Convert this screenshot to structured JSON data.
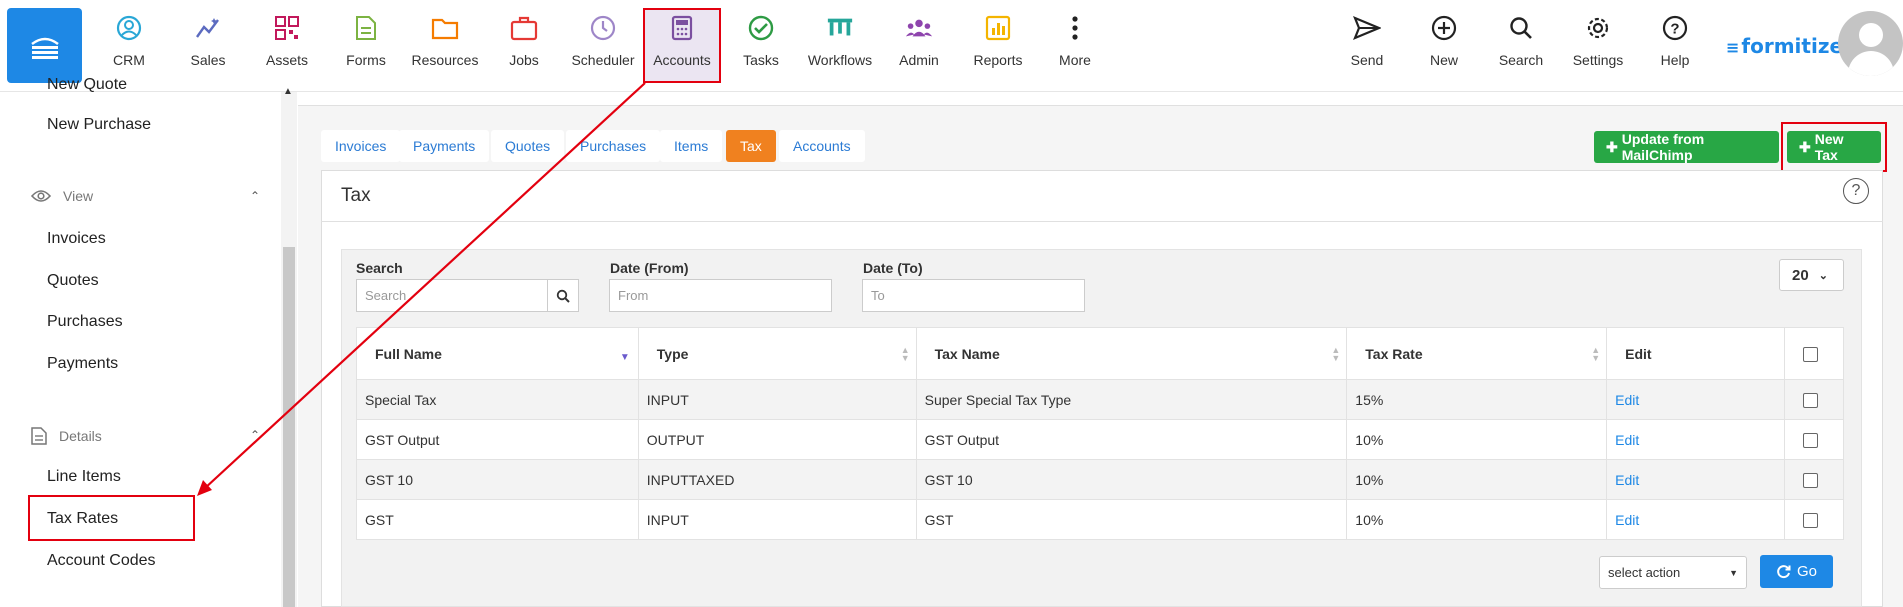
{
  "nav": {
    "items": [
      {
        "label": "CRM",
        "icon": "crm-icon",
        "color": "#29a7d6"
      },
      {
        "label": "Sales",
        "icon": "sales-icon",
        "color": "#5c6bc0"
      },
      {
        "label": "Assets",
        "icon": "assets-qr-icon",
        "color": "#c2185b"
      },
      {
        "label": "Forms",
        "icon": "forms-icon",
        "color": "#7cb342"
      },
      {
        "label": "Resources",
        "icon": "folder-icon",
        "color": "#f57c00"
      },
      {
        "label": "Jobs",
        "icon": "briefcase-icon",
        "color": "#e53935"
      },
      {
        "label": "Scheduler",
        "icon": "clock-icon",
        "color": "#9e86c8"
      },
      {
        "label": "Accounts",
        "icon": "calculator-icon",
        "color": "#7b4fa0"
      },
      {
        "label": "Tasks",
        "icon": "check-circle-icon",
        "color": "#2e9b44"
      },
      {
        "label": "Workflows",
        "icon": "workflow-icon",
        "color": "#26a69a"
      },
      {
        "label": "Admin",
        "icon": "admin-users-icon",
        "color": "#8e44ad"
      },
      {
        "label": "Reports",
        "icon": "reports-icon",
        "color": "#f4b400"
      },
      {
        "label": "More",
        "icon": "more-dots-icon",
        "color": "#222222"
      }
    ],
    "right_items": [
      {
        "label": "Send",
        "icon": "send-icon"
      },
      {
        "label": "New",
        "icon": "plus-circle-icon"
      },
      {
        "label": "Search",
        "icon": "search-icon"
      },
      {
        "label": "Settings",
        "icon": "gear-icon"
      },
      {
        "label": "Help",
        "icon": "help-circle-icon"
      }
    ],
    "logo": "formitize"
  },
  "sidebar": {
    "top_links": [
      "New Quote",
      "New Purchase"
    ],
    "view_section": {
      "label": "View",
      "links": [
        "Invoices",
        "Quotes",
        "Purchases",
        "Payments"
      ]
    },
    "details_section": {
      "label": "Details",
      "links": [
        "Line Items",
        "Tax Rates",
        "Account Codes"
      ]
    }
  },
  "tabs": [
    "Invoices",
    "Payments",
    "Quotes",
    "Purchases",
    "Items",
    "Tax",
    "Accounts"
  ],
  "active_tab": "Tax",
  "buttons": {
    "mailchimp": "Update from MailChimp",
    "new_tax": "New Tax",
    "go": "Go"
  },
  "panel": {
    "title": "Tax"
  },
  "filters": {
    "search_label": "Search",
    "search_placeholder": "Search",
    "from_label": "Date (From)",
    "from_placeholder": "From",
    "to_label": "Date (To)",
    "to_placeholder": "To",
    "page_size": "20"
  },
  "table": {
    "columns": [
      "Full Name",
      "Type",
      "Tax Name",
      "Tax Rate",
      "Edit"
    ],
    "rows": [
      {
        "full_name": "Special Tax",
        "type": "INPUT",
        "tax_name": "Super Special Tax Type",
        "rate": "15%",
        "edit": "Edit"
      },
      {
        "full_name": "GST Output",
        "type": "OUTPUT",
        "tax_name": "GST Output",
        "rate": "10%",
        "edit": "Edit"
      },
      {
        "full_name": "GST 10",
        "type": "INPUTTAXED",
        "tax_name": "GST 10",
        "rate": "10%",
        "edit": "Edit"
      },
      {
        "full_name": "GST",
        "type": "INPUT",
        "tax_name": "GST",
        "rate": "10%",
        "edit": "Edit"
      }
    ]
  },
  "bulk_action": {
    "placeholder": "select action"
  },
  "colors": {
    "primary": "#1e88e5",
    "active_tab": "#f0811f",
    "green": "#28a745",
    "highlight": "#e3000f"
  }
}
